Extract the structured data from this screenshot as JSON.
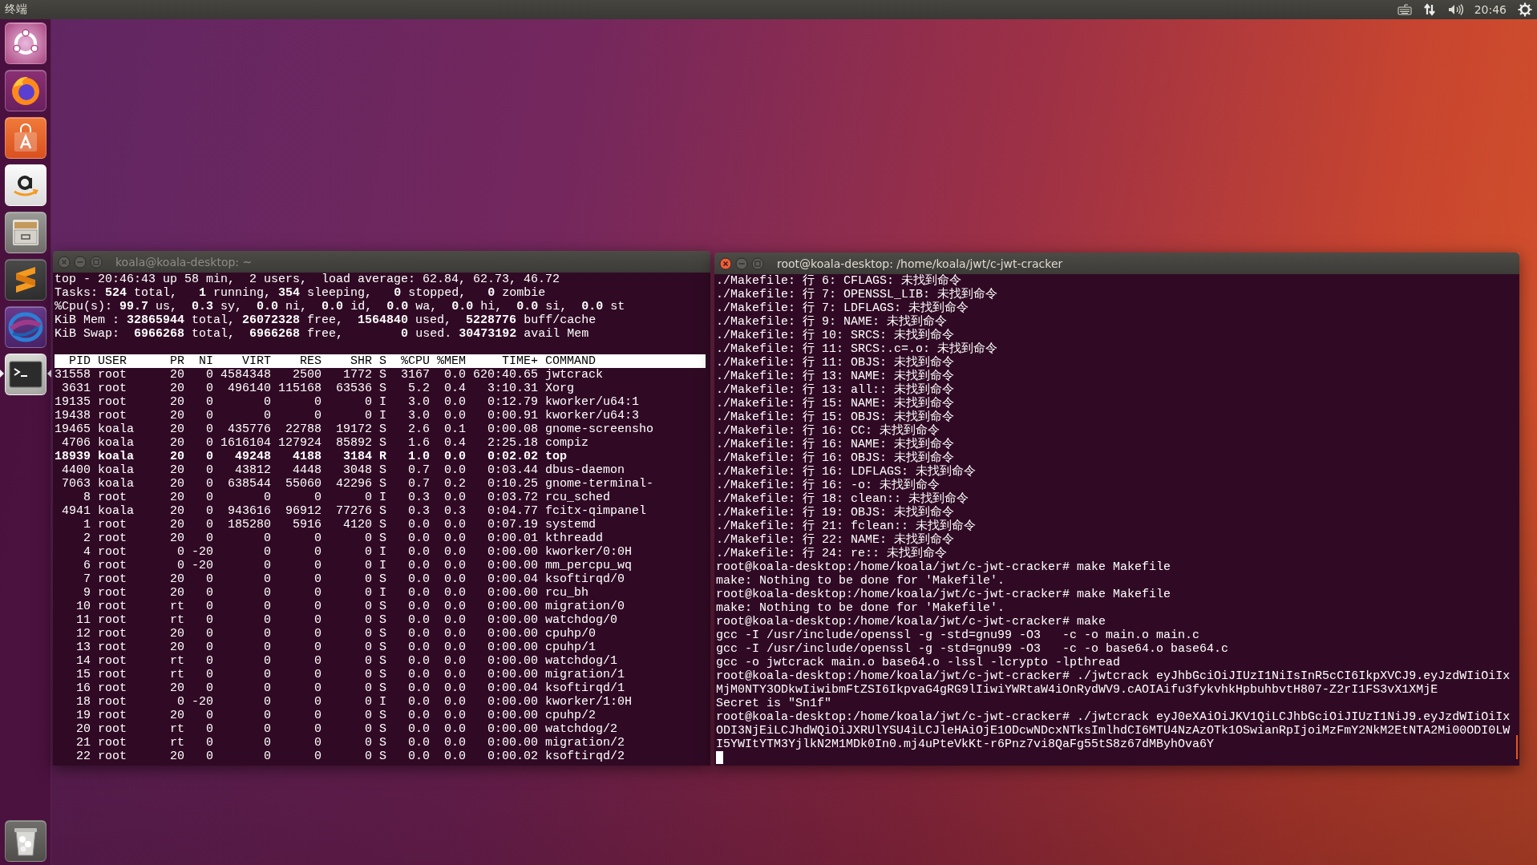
{
  "top_bar": {
    "title": "终端",
    "clock": "20:46"
  },
  "launcher": {
    "items": [
      {
        "kind": "ring",
        "active": false
      },
      {
        "kind": "flame",
        "active": false
      },
      {
        "kind": "bag",
        "active": false
      },
      {
        "kind": "smile",
        "active": false
      },
      {
        "kind": "cabinet",
        "active": false
      },
      {
        "kind": "zigzag",
        "active": false
      },
      {
        "kind": "swirl",
        "active": false
      },
      {
        "kind": "terminal",
        "active": true
      },
      {
        "kind": "trash",
        "active": false
      }
    ]
  },
  "windows": [
    {
      "kind": "top",
      "title": "koala@koala-desktop: ~",
      "focused": false,
      "summary": [
        "top - 20:46:43 up 58 min,  2 users,  load average: 62.84, 62.73, 46.72",
        "Tasks: **524** total,   **1** running, **354** sleeping,   **0** stopped,   **0** zombie",
        "%Cpu(s): **99.7** us,  **0.3** sy,  **0.0** ni,  **0.0** id,  **0.0** wa,  **0.0** hi,  **0.0** si,  **0.0** st",
        "KiB Mem : **32865944** total, **26072328** free,  **1564840** used,  **5228776** buff/cache",
        "KiB Swap:  **6966268** total,  **6966268** free,        **0** used. **30473192** avail Mem"
      ],
      "columns": [
        "PID",
        "USER",
        "PR",
        "NI",
        "VIRT",
        "RES",
        "SHR",
        "S",
        "%CPU",
        "%MEM",
        "TIME+",
        "COMMAND"
      ],
      "rows": [
        {
          "highlighted": false,
          "cells": [
            "31558",
            "root",
            "20",
            "0",
            "4584348",
            "2500",
            "1772",
            "S",
            "3167",
            "0.0",
            "620:40.65",
            "jwtcrack"
          ]
        },
        {
          "highlighted": false,
          "cells": [
            "3631",
            "root",
            "20",
            "0",
            "496140",
            "115168",
            "63536",
            "S",
            "5.2",
            "0.4",
            "3:10.31",
            "Xorg"
          ]
        },
        {
          "highlighted": false,
          "cells": [
            "19135",
            "root",
            "20",
            "0",
            "0",
            "0",
            "0",
            "I",
            "3.0",
            "0.0",
            "0:12.79",
            "kworker/u64:1"
          ]
        },
        {
          "highlighted": false,
          "cells": [
            "19438",
            "root",
            "20",
            "0",
            "0",
            "0",
            "0",
            "I",
            "3.0",
            "0.0",
            "0:00.91",
            "kworker/u64:3"
          ]
        },
        {
          "highlighted": false,
          "cells": [
            "19465",
            "koala",
            "20",
            "0",
            "435776",
            "22788",
            "19172",
            "S",
            "2.6",
            "0.1",
            "0:00.08",
            "gnome-screensho"
          ]
        },
        {
          "highlighted": false,
          "cells": [
            "4706",
            "koala",
            "20",
            "0",
            "1616104",
            "127924",
            "85892",
            "S",
            "1.6",
            "0.4",
            "2:25.18",
            "compiz"
          ]
        },
        {
          "highlighted": true,
          "cells": [
            "18939",
            "koala",
            "20",
            "0",
            "49248",
            "4188",
            "3184",
            "R",
            "1.0",
            "0.0",
            "0:02.02",
            "top"
          ]
        },
        {
          "highlighted": false,
          "cells": [
            "4400",
            "koala",
            "20",
            "0",
            "43812",
            "4448",
            "3048",
            "S",
            "0.7",
            "0.0",
            "0:03.44",
            "dbus-daemon"
          ]
        },
        {
          "highlighted": false,
          "cells": [
            "7063",
            "koala",
            "20",
            "0",
            "638544",
            "55060",
            "42296",
            "S",
            "0.7",
            "0.2",
            "0:10.25",
            "gnome-terminal-"
          ]
        },
        {
          "highlighted": false,
          "cells": [
            "8",
            "root",
            "20",
            "0",
            "0",
            "0",
            "0",
            "I",
            "0.3",
            "0.0",
            "0:03.72",
            "rcu_sched"
          ]
        },
        {
          "highlighted": false,
          "cells": [
            "4941",
            "koala",
            "20",
            "0",
            "943616",
            "96912",
            "77276",
            "S",
            "0.3",
            "0.3",
            "0:04.77",
            "fcitx-qimpanel"
          ]
        },
        {
          "highlighted": false,
          "cells": [
            "1",
            "root",
            "20",
            "0",
            "185280",
            "5916",
            "4120",
            "S",
            "0.0",
            "0.0",
            "0:07.19",
            "systemd"
          ]
        },
        {
          "highlighted": false,
          "cells": [
            "2",
            "root",
            "20",
            "0",
            "0",
            "0",
            "0",
            "S",
            "0.0",
            "0.0",
            "0:00.01",
            "kthreadd"
          ]
        },
        {
          "highlighted": false,
          "cells": [
            "4",
            "root",
            "0",
            "-20",
            "0",
            "0",
            "0",
            "I",
            "0.0",
            "0.0",
            "0:00.00",
            "kworker/0:0H"
          ]
        },
        {
          "highlighted": false,
          "cells": [
            "6",
            "root",
            "0",
            "-20",
            "0",
            "0",
            "0",
            "I",
            "0.0",
            "0.0",
            "0:00.00",
            "mm_percpu_wq"
          ]
        },
        {
          "highlighted": false,
          "cells": [
            "7",
            "root",
            "20",
            "0",
            "0",
            "0",
            "0",
            "S",
            "0.0",
            "0.0",
            "0:00.04",
            "ksoftirqd/0"
          ]
        },
        {
          "highlighted": false,
          "cells": [
            "9",
            "root",
            "20",
            "0",
            "0",
            "0",
            "0",
            "I",
            "0.0",
            "0.0",
            "0:00.00",
            "rcu_bh"
          ]
        },
        {
          "highlighted": false,
          "cells": [
            "10",
            "root",
            "rt",
            "0",
            "0",
            "0",
            "0",
            "S",
            "0.0",
            "0.0",
            "0:00.00",
            "migration/0"
          ]
        },
        {
          "highlighted": false,
          "cells": [
            "11",
            "root",
            "rt",
            "0",
            "0",
            "0",
            "0",
            "S",
            "0.0",
            "0.0",
            "0:00.00",
            "watchdog/0"
          ]
        },
        {
          "highlighted": false,
          "cells": [
            "12",
            "root",
            "20",
            "0",
            "0",
            "0",
            "0",
            "S",
            "0.0",
            "0.0",
            "0:00.00",
            "cpuhp/0"
          ]
        },
        {
          "highlighted": false,
          "cells": [
            "13",
            "root",
            "20",
            "0",
            "0",
            "0",
            "0",
            "S",
            "0.0",
            "0.0",
            "0:00.00",
            "cpuhp/1"
          ]
        },
        {
          "highlighted": false,
          "cells": [
            "14",
            "root",
            "rt",
            "0",
            "0",
            "0",
            "0",
            "S",
            "0.0",
            "0.0",
            "0:00.00",
            "watchdog/1"
          ]
        },
        {
          "highlighted": false,
          "cells": [
            "15",
            "root",
            "rt",
            "0",
            "0",
            "0",
            "0",
            "S",
            "0.0",
            "0.0",
            "0:00.00",
            "migration/1"
          ]
        },
        {
          "highlighted": false,
          "cells": [
            "16",
            "root",
            "20",
            "0",
            "0",
            "0",
            "0",
            "S",
            "0.0",
            "0.0",
            "0:00.04",
            "ksoftirqd/1"
          ]
        },
        {
          "highlighted": false,
          "cells": [
            "18",
            "root",
            "0",
            "-20",
            "0",
            "0",
            "0",
            "I",
            "0.0",
            "0.0",
            "0:00.00",
            "kworker/1:0H"
          ]
        },
        {
          "highlighted": false,
          "cells": [
            "19",
            "root",
            "20",
            "0",
            "0",
            "0",
            "0",
            "S",
            "0.0",
            "0.0",
            "0:00.00",
            "cpuhp/2"
          ]
        },
        {
          "highlighted": false,
          "cells": [
            "20",
            "root",
            "rt",
            "0",
            "0",
            "0",
            "0",
            "S",
            "0.0",
            "0.0",
            "0:00.00",
            "watchdog/2"
          ]
        },
        {
          "highlighted": false,
          "cells": [
            "21",
            "root",
            "rt",
            "0",
            "0",
            "0",
            "0",
            "S",
            "0.0",
            "0.0",
            "0:00.00",
            "migration/2"
          ]
        },
        {
          "highlighted": false,
          "cells": [
            "22",
            "root",
            "20",
            "0",
            "0",
            "0",
            "0",
            "S",
            "0.0",
            "0.0",
            "0:00.02",
            "ksoftirqd/2"
          ]
        }
      ]
    },
    {
      "kind": "shell",
      "title": "root@koala-desktop: /home/koala/jwt/c-jwt-cracker",
      "focused": true,
      "lines": [
        "./Makefile: 行 6: CFLAGS: 未找到命令",
        "./Makefile: 行 7: OPENSSL_LIB: 未找到命令",
        "./Makefile: 行 7: LDFLAGS: 未找到命令",
        "./Makefile: 行 9: NAME: 未找到命令",
        "./Makefile: 行 10: SRCS: 未找到命令",
        "./Makefile: 行 11: SRCS:.c=.o: 未找到命令",
        "./Makefile: 行 11: OBJS: 未找到命令",
        "./Makefile: 行 13: NAME: 未找到命令",
        "./Makefile: 行 13: all:: 未找到命令",
        "./Makefile: 行 15: NAME: 未找到命令",
        "./Makefile: 行 15: OBJS: 未找到命令",
        "./Makefile: 行 16: CC: 未找到命令",
        "./Makefile: 行 16: NAME: 未找到命令",
        "./Makefile: 行 16: OBJS: 未找到命令",
        "./Makefile: 行 16: LDFLAGS: 未找到命令",
        "./Makefile: 行 16: -o: 未找到命令",
        "./Makefile: 行 18: clean:: 未找到命令",
        "./Makefile: 行 19: OBJS: 未找到命令",
        "./Makefile: 行 21: fclean:: 未找到命令",
        "./Makefile: 行 22: NAME: 未找到命令",
        "./Makefile: 行 24: re:: 未找到命令",
        "root@koala-desktop:/home/koala/jwt/c-jwt-cracker# make Makefile",
        "make: Nothing to be done for 'Makefile'.",
        "root@koala-desktop:/home/koala/jwt/c-jwt-cracker# make Makefile",
        "make: Nothing to be done for 'Makefile'.",
        "root@koala-desktop:/home/koala/jwt/c-jwt-cracker# make",
        "gcc -I /usr/include/openssl -g -std=gnu99 -O3   -c -o main.o main.c",
        "gcc -I /usr/include/openssl -g -std=gnu99 -O3   -c -o base64.o base64.c",
        "gcc -o jwtcrack main.o base64.o -lssl -lcrypto -lpthread",
        "root@koala-desktop:/home/koala/jwt/c-jwt-cracker# ./jwtcrack eyJhbGciOiJIUzI1NiIsInR5cCI6IkpXVCJ9.eyJzdWIiOiIx",
        "MjM0NTY3ODkwIiwibmFtZSI6IkpvaG4gRG9lIiwiYWRtaW4iOnRydWV9.cAOIAifu3fykvhkHpbuhbvtH807-Z2rI1FS3vX1XMjE",
        "Secret is \"Sn1f\"",
        "root@koala-desktop:/home/koala/jwt/c-jwt-cracker# ./jwtcrack eyJ0eXAiOiJKV1QiLCJhbGciOiJIUzI1NiJ9.eyJzdWIiOiIx",
        "ODI3NjEiLCJhdWQiOiJXRUlYSU4iLCJleHAiOjE1ODcwNDcxNTksImlhdCI6MTU4NzAzOTk1OSwianRpIjoiMzFmY2NkM2EtNTA2Mi00ODI0LW",
        "I5YWItYTM3YjlkN2M1MDk0In0.mj4uPteVkKt-r6Pnz7vi8QaFg55tS8z67dMByhOva6Y"
      ]
    }
  ]
}
